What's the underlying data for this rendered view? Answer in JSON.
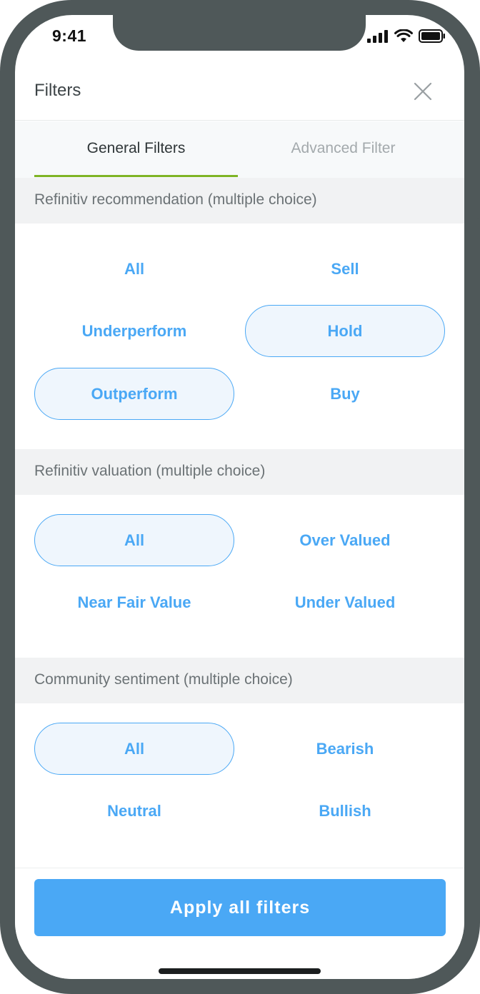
{
  "status_bar": {
    "time": "9:41"
  },
  "header": {
    "title": "Filters"
  },
  "tabs": [
    {
      "label": "General Filters",
      "active": true
    },
    {
      "label": "Advanced Filter",
      "active": false
    }
  ],
  "sections": [
    {
      "title": "Refinitiv recommendation (multiple choice)",
      "options": [
        {
          "label": "All",
          "selected": false
        },
        {
          "label": "Sell",
          "selected": false
        },
        {
          "label": "Underperform",
          "selected": false
        },
        {
          "label": "Hold",
          "selected": true
        },
        {
          "label": "Outperform",
          "selected": true
        },
        {
          "label": "Buy",
          "selected": false
        }
      ]
    },
    {
      "title": "Refinitiv valuation (multiple choice)",
      "options": [
        {
          "label": "All",
          "selected": true
        },
        {
          "label": "Over Valued",
          "selected": false
        },
        {
          "label": "Near Fair Value",
          "selected": false
        },
        {
          "label": "Under Valued",
          "selected": false
        }
      ]
    },
    {
      "title": "Community sentiment (multiple choice)",
      "options": [
        {
          "label": "All",
          "selected": true
        },
        {
          "label": "Bearish",
          "selected": false
        },
        {
          "label": "Neutral",
          "selected": false
        },
        {
          "label": "Bullish",
          "selected": false
        }
      ]
    }
  ],
  "footer": {
    "apply_label": "Apply all filters"
  },
  "colors": {
    "accent": "#4aa8f5",
    "tab_indicator": "#7fb424",
    "chip_selected_bg": "#eff6fd",
    "frame": "#4f5859"
  }
}
